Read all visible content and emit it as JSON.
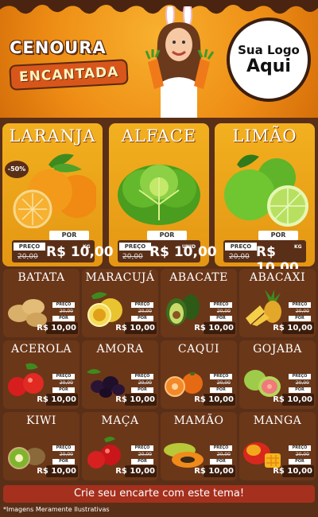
{
  "header": {
    "title_line1": "CENOURA",
    "title_line2": "ENCANTADA",
    "logo_line1": "Sua Logo",
    "logo_line2": "Aqui"
  },
  "featured": [
    {
      "name": "LARANJA",
      "badge": "-50%",
      "preco_label": "PREÇO",
      "old_price": "20,00",
      "por_label": "POR",
      "price": "R$ 10,00",
      "unit": "KG"
    },
    {
      "name": "ALFACE",
      "preco_label": "PREÇO",
      "old_price": "20,00",
      "por_label": "POR",
      "price": "R$ 10,00",
      "unit": "UNID"
    },
    {
      "name": "LIMÃO",
      "preco_label": "PREÇO",
      "old_price": "20,00",
      "por_label": "POR",
      "price": "R$ 10,00",
      "unit": "KG"
    }
  ],
  "products": [
    {
      "name": "BATATA",
      "preco_label": "PREÇO",
      "old_price": "20,00",
      "por_label": "POR",
      "price": "R$ 10,00"
    },
    {
      "name": "MARACUJÁ",
      "preco_label": "PREÇO",
      "old_price": "20,00",
      "por_label": "POR",
      "price": "R$ 10,00"
    },
    {
      "name": "ABACATE",
      "preco_label": "PREÇO",
      "old_price": "20,00",
      "por_label": "POR",
      "price": "R$ 10,00"
    },
    {
      "name": "ABACAXI",
      "preco_label": "PREÇO",
      "old_price": "20,00",
      "por_label": "POR",
      "price": "R$ 10,00"
    },
    {
      "name": "ACEROLA",
      "preco_label": "PREÇO",
      "old_price": "20,00",
      "por_label": "POR",
      "price": "R$ 10,00"
    },
    {
      "name": "AMORA",
      "preco_label": "PREÇO",
      "old_price": "20,00",
      "por_label": "POR",
      "price": "R$ 10,00"
    },
    {
      "name": "CAQUI",
      "preco_label": "PREÇO",
      "old_price": "20,00",
      "por_label": "POR",
      "price": "R$ 10,00"
    },
    {
      "name": "GOJABA",
      "preco_label": "PREÇO",
      "old_price": "20,00",
      "por_label": "POR",
      "price": "R$ 10,00"
    },
    {
      "name": "KIWI",
      "preco_label": "PREÇO",
      "old_price": "20,00",
      "por_label": "POR",
      "price": "R$ 10,00"
    },
    {
      "name": "MAÇA",
      "preco_label": "PREÇO",
      "old_price": "20,00",
      "por_label": "POR",
      "price": "R$ 10,00"
    },
    {
      "name": "MAMÃO",
      "preco_label": "PREÇO",
      "old_price": "20,00",
      "por_label": "POR",
      "price": "R$ 10,00"
    },
    {
      "name": "MANGA",
      "preco_label": "PREÇO",
      "old_price": "20,00",
      "por_label": "POR",
      "price": "R$ 10,00"
    }
  ],
  "footer": {
    "banner": "Crie seu encarte com este tema!",
    "note": "*Imagens Meramente Ilustrativas"
  },
  "colors": {
    "background": "#5a2f18",
    "header_orange": "#ee8d15",
    "card_gold": "#f2b01f",
    "card_brown": "#6b3719",
    "banner_red": "#a5301d"
  }
}
